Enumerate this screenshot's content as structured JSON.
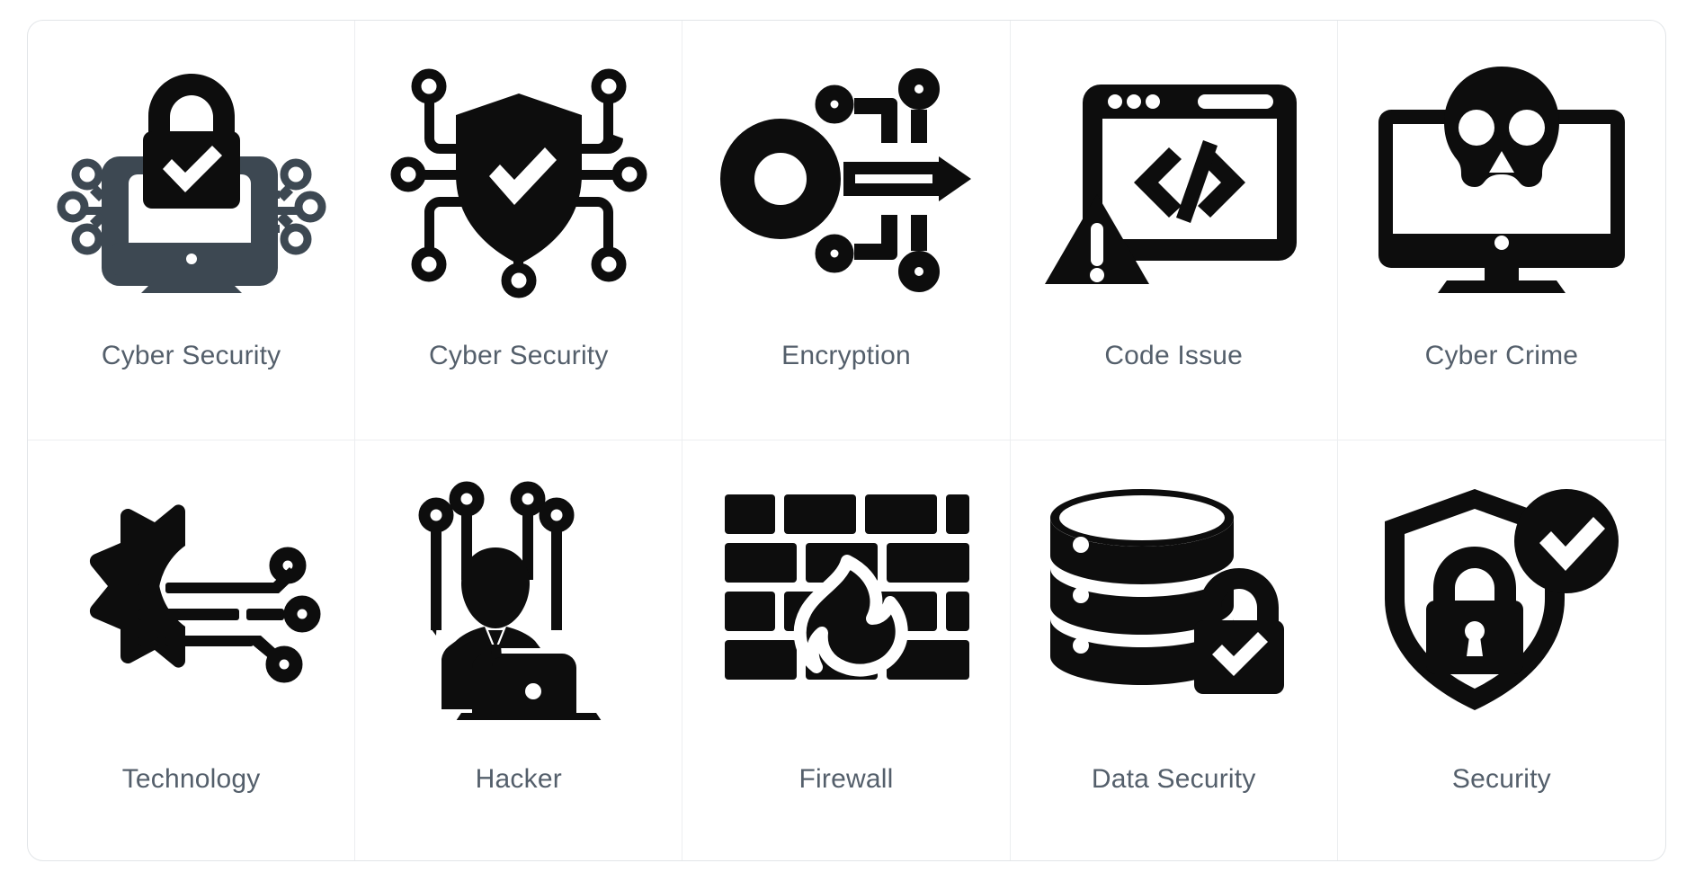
{
  "sheet": {
    "columns": 5,
    "rows": 2,
    "background": "#ffffff",
    "border_color": "#e2e5e8",
    "divider_color": "#eceef0",
    "label_color": "#545f6b",
    "icon_color": "#0d0d0d",
    "icon_accent_color": "#3d4852"
  },
  "icons": [
    {
      "id": "cyber-security-monitor-lock",
      "label": "Cyber Security",
      "depicts": "computer monitor with padlock and checkmark plus circuit nodes",
      "color": "#3d4852"
    },
    {
      "id": "cyber-security-shield-nodes",
      "label": "Cyber Security",
      "depicts": "shield with checkmark connected to circuit nodes",
      "color": "#0d0d0d"
    },
    {
      "id": "encryption",
      "label": "Encryption",
      "depicts": "ring with arrow and circuit nodes",
      "color": "#0d0d0d"
    },
    {
      "id": "code-issue",
      "label": "Code Issue",
      "depicts": "browser window with code brackets and warning triangle",
      "color": "#0d0d0d"
    },
    {
      "id": "cyber-crime",
      "label": "Cyber Crime",
      "depicts": "monitor with skull",
      "color": "#0d0d0d"
    },
    {
      "id": "technology",
      "label": "Technology",
      "depicts": "half gear with circuit traces and nodes",
      "color": "#0d0d0d"
    },
    {
      "id": "hacker",
      "label": "Hacker",
      "depicts": "person at laptop with antenna nodes",
      "color": "#0d0d0d"
    },
    {
      "id": "firewall",
      "label": "Firewall",
      "depicts": "brick wall with flame",
      "color": "#0d0d0d"
    },
    {
      "id": "data-security",
      "label": "Data Security",
      "depicts": "database stack with padlock and checkmark",
      "color": "#0d0d0d"
    },
    {
      "id": "security",
      "label": "Security",
      "depicts": "shield with padlock and check badge",
      "color": "#0d0d0d"
    }
  ]
}
